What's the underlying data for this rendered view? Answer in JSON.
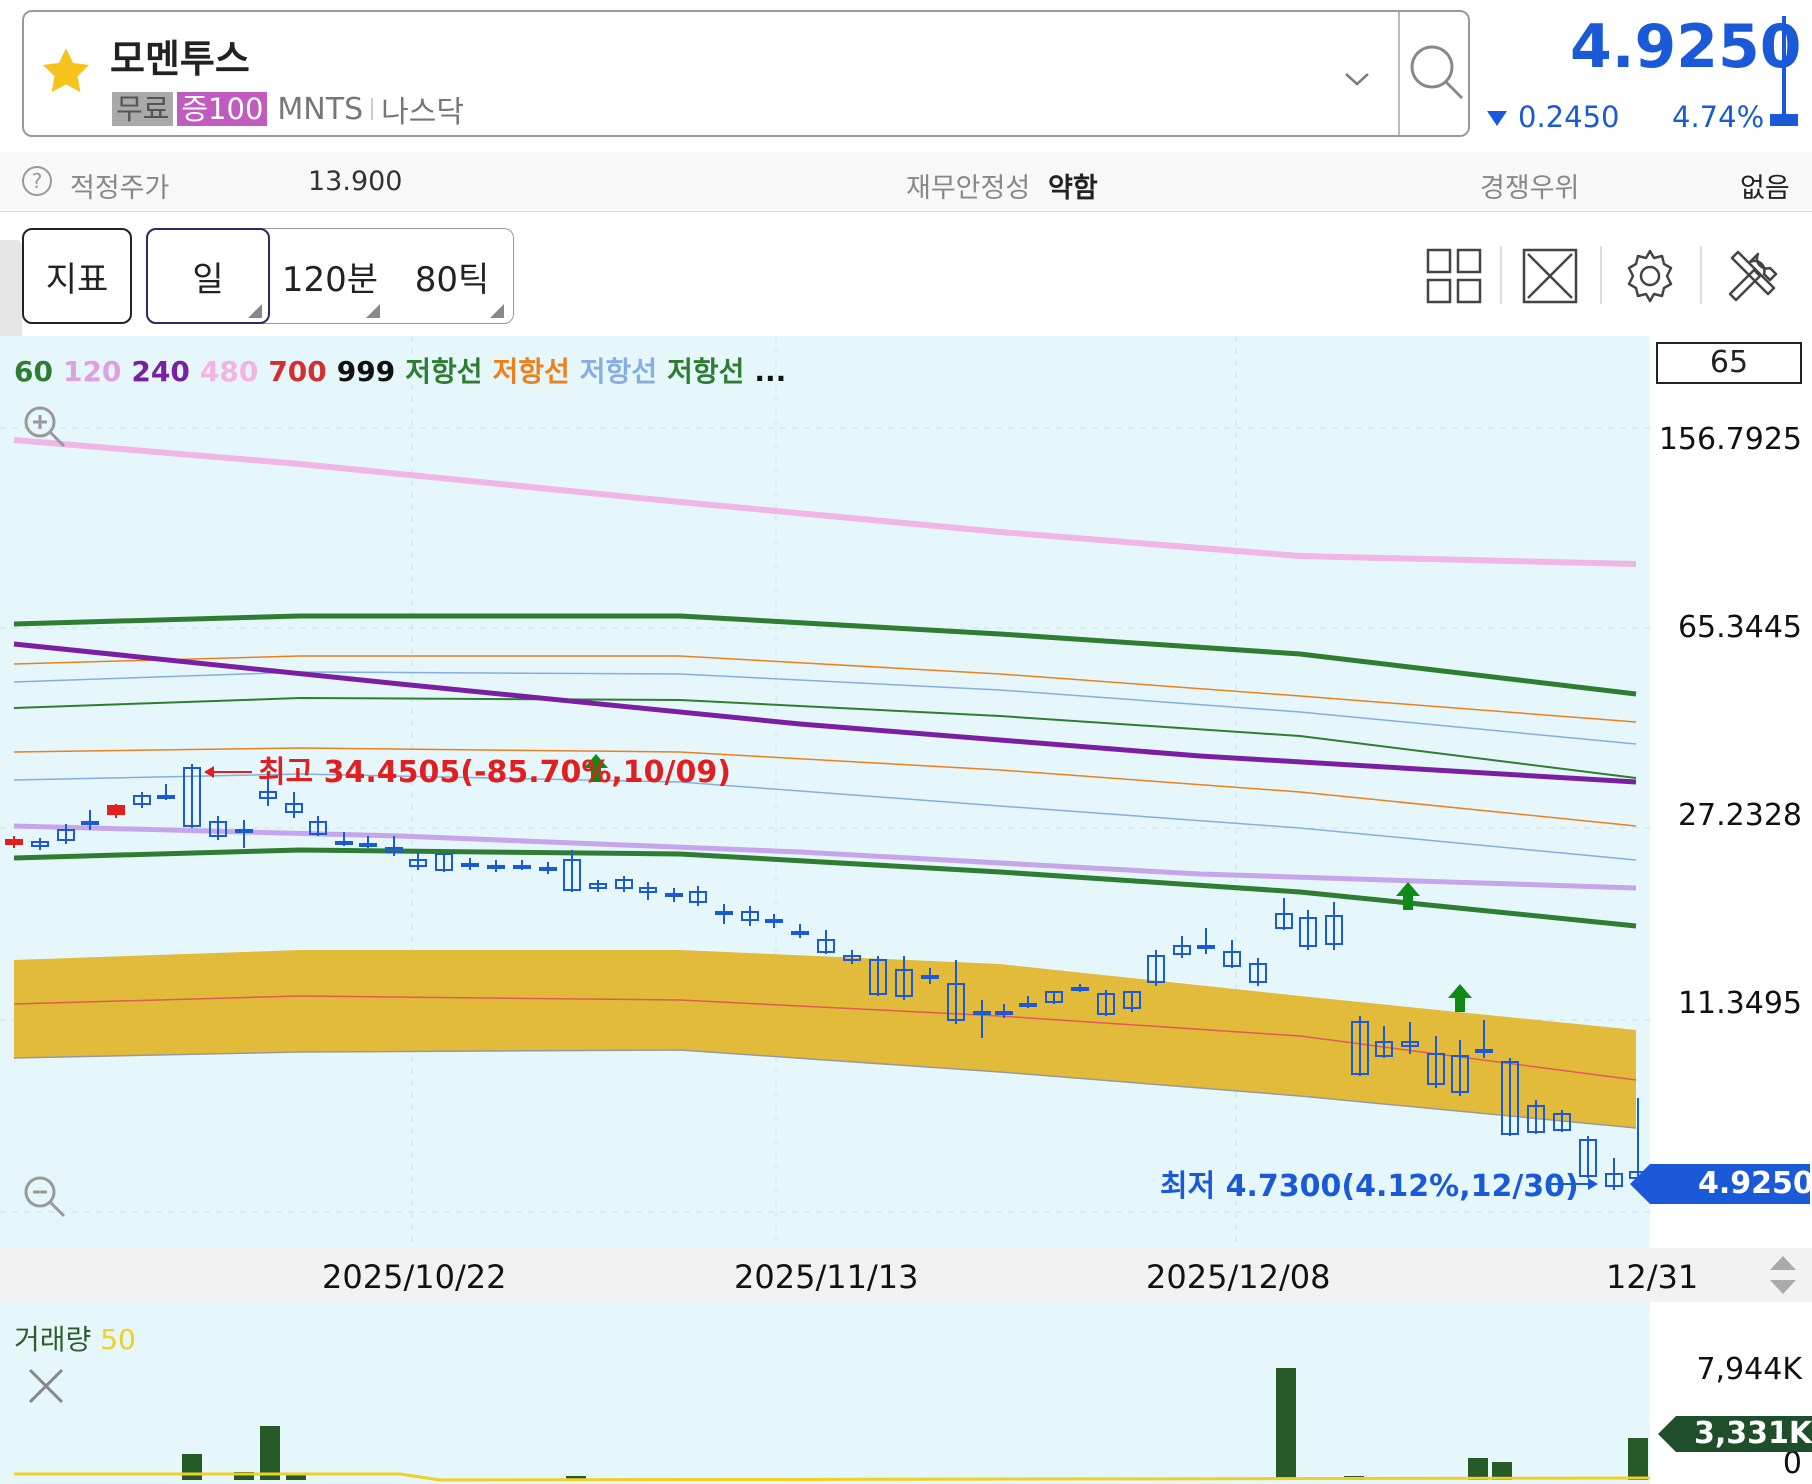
{
  "header": {
    "stock_name": "모멘투스",
    "badge_free": "무료",
    "badge_margin": "증100",
    "ticker": "MNTS",
    "exchange": "나스닥",
    "price": "4.9250",
    "change": "0.2450",
    "change_pct": "4.74%",
    "colors": {
      "down": "#1a5ad8",
      "star": "#f6c21c",
      "margin_badge": "#c05bc0"
    }
  },
  "fair_value_row": {
    "fair_label": "적정주가",
    "fair_value": "13.900",
    "stability_label": "재무안정성",
    "stability_value": "약함",
    "advantage_label": "경쟁우위",
    "advantage_value": "없음"
  },
  "toolbar": {
    "indicator_label": "지표",
    "period_day": "일",
    "period_120": "120분",
    "period_80": "80틱"
  },
  "chart_legend": {
    "items": [
      {
        "label": "60",
        "color": "#2e7d32"
      },
      {
        "label": "120",
        "color": "#e0a0e0"
      },
      {
        "label": "240",
        "color": "#7b1fa2"
      },
      {
        "label": "480",
        "color": "#f3b3e3"
      },
      {
        "label": "700",
        "color": "#d32f2f"
      },
      {
        "label": "999",
        "color": "#111111"
      },
      {
        "label": "저항선",
        "color": "#2e7d32"
      },
      {
        "label": "저항선",
        "color": "#ef7f1a"
      },
      {
        "label": "저항선",
        "color": "#86aee0"
      },
      {
        "label": "저항선",
        "color": "#2e7d32"
      },
      {
        "label": "...",
        "color": "#111111"
      }
    ]
  },
  "chart_data": {
    "type": "line",
    "y_axis": {
      "scale": "log",
      "tick_labels": [
        "156.7925",
        "65.3445",
        "27.2328",
        "11.3495"
      ],
      "box_value": "65"
    },
    "x_axis": {
      "tick_labels": [
        "2025/10/22",
        "2025/11/13",
        "2025/12/08",
        "12/31"
      ]
    },
    "current_price": "4.9250",
    "high_annotation": "최고 34.4505(-85.70%,10/09)",
    "low_annotation": "최저 4.7300(4.12%,12/30)",
    "volume": {
      "label": "거래량",
      "period": "50",
      "tick_labels": [
        "7,944K",
        "0"
      ],
      "current": "3,331K"
    }
  }
}
